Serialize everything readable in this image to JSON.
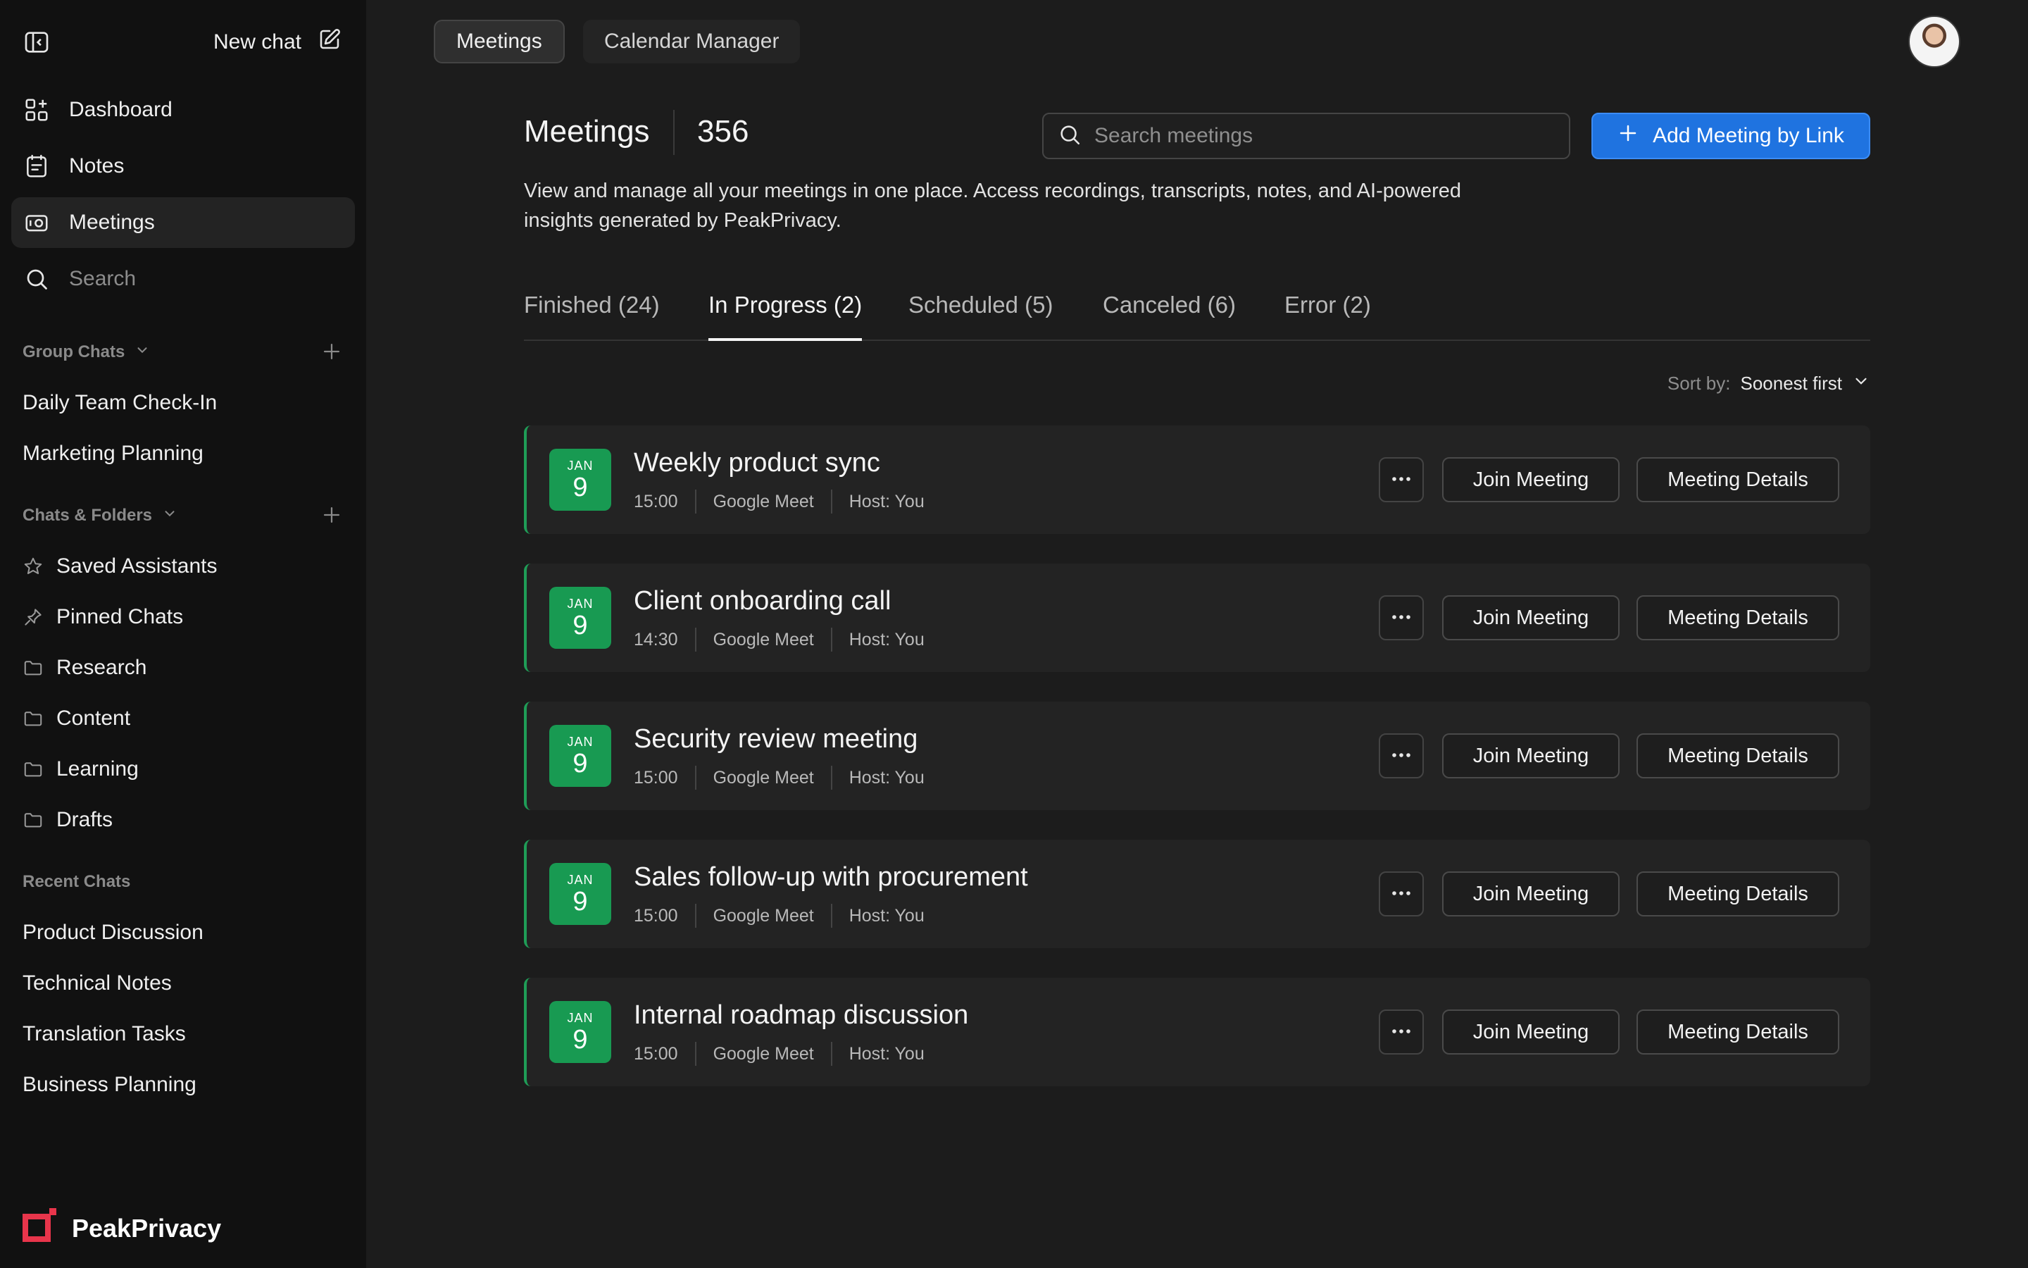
{
  "sidebar": {
    "new_chat_label": "New chat",
    "nav": [
      {
        "label": "Dashboard",
        "icon": "grid-plus-icon"
      },
      {
        "label": "Notes",
        "icon": "notes-icon"
      },
      {
        "label": "Meetings",
        "icon": "video-icon"
      },
      {
        "label": "Search",
        "icon": "search-icon"
      }
    ],
    "group_chats": {
      "heading": "Group Chats",
      "items": [
        "Daily Team Check-In",
        "Marketing Planning"
      ]
    },
    "chats_folders": {
      "heading": "Chats & Folders",
      "items": [
        {
          "label": "Saved Assistants",
          "icon": "star-icon"
        },
        {
          "label": "Pinned Chats",
          "icon": "pin-icon"
        },
        {
          "label": "Research",
          "icon": "folder-icon"
        },
        {
          "label": "Content",
          "icon": "folder-icon"
        },
        {
          "label": "Learning",
          "icon": "folder-icon"
        },
        {
          "label": "Drafts",
          "icon": "folder-icon"
        }
      ]
    },
    "recent_chats": {
      "heading": "Recent Chats",
      "items": [
        "Product Discussion",
        "Technical Notes",
        "Translation Tasks",
        "Business Planning"
      ]
    },
    "brand_name": "PeakPrivacy"
  },
  "topbar": {
    "tabs": [
      "Meetings",
      "Calendar Manager"
    ]
  },
  "main": {
    "title": "Meetings",
    "count": "356",
    "search_placeholder": "Search meetings",
    "add_button_label": "Add Meeting by Link",
    "description": "View and manage all your meetings in one place. Access recordings, transcripts, notes, and AI-powered insights generated by PeakPrivacy.",
    "tabs": [
      "Finished (24)",
      "In Progress (2)",
      "Scheduled (5)",
      "Canceled (6)",
      "Error (2)"
    ],
    "sort_label": "Sort by:",
    "sort_value": "Soonest first",
    "join_label": "Join Meeting",
    "details_label": "Meeting Details",
    "meetings": [
      {
        "month": "JAN",
        "day": "9",
        "title": "Weekly product sync",
        "time": "15:00",
        "platform": "Google Meet",
        "host": "Host: You"
      },
      {
        "month": "JAN",
        "day": "9",
        "title": "Client onboarding call",
        "time": "14:30",
        "platform": "Google Meet",
        "host": "Host: You"
      },
      {
        "month": "JAN",
        "day": "9",
        "title": "Security review meeting",
        "time": "15:00",
        "platform": "Google Meet",
        "host": "Host: You"
      },
      {
        "month": "JAN",
        "day": "9",
        "title": "Sales follow-up with procurement",
        "time": "15:00",
        "platform": "Google Meet",
        "host": "Host: You"
      },
      {
        "month": "JAN",
        "day": "9",
        "title": "Internal roadmap discussion",
        "time": "15:00",
        "platform": "Google Meet",
        "host": "Host: You"
      }
    ]
  },
  "colors": {
    "accent_blue": "#1f73e0",
    "date_green": "#189a52",
    "brand_red": "#e8354b"
  }
}
